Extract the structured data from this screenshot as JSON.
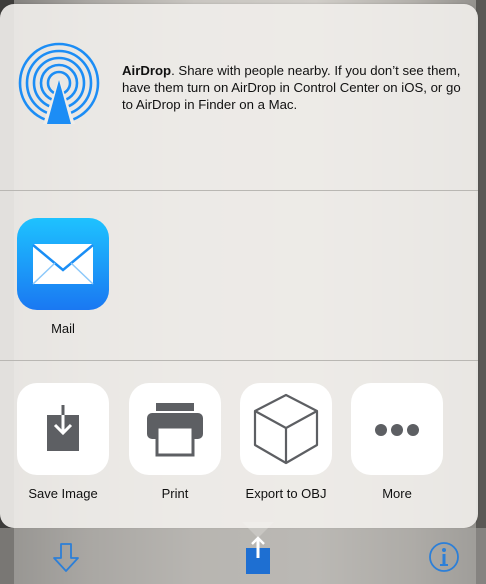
{
  "airdrop": {
    "title": "AirDrop",
    "description": ". Share with people nearby. If you don’t see them, have them turn on AirDrop in Control Center on iOS, or go to AirDrop in Finder on a Mac.",
    "icon": "airdrop-icon"
  },
  "share_apps": [
    {
      "label": "Mail",
      "icon": "mail-icon"
    }
  ],
  "actions": [
    {
      "label": "Save Image",
      "icon": "save-image-icon"
    },
    {
      "label": "Print",
      "icon": "printer-icon"
    },
    {
      "label": "Export to OBJ",
      "icon": "cube-icon"
    },
    {
      "label": "More",
      "icon": "more-dots-icon"
    }
  ],
  "toolbar": {
    "buttons": [
      {
        "icon": "download-arrow-icon"
      },
      {
        "icon": "share-icon"
      },
      {
        "icon": "info-icon"
      }
    ]
  },
  "colors": {
    "accent": "#1a78f2",
    "mail_gradient_top": "#1ec2ff",
    "mail_gradient_bottom": "#1a78f2",
    "icon_gray": "#5d5f63",
    "sheet_bg": "#efedea"
  }
}
